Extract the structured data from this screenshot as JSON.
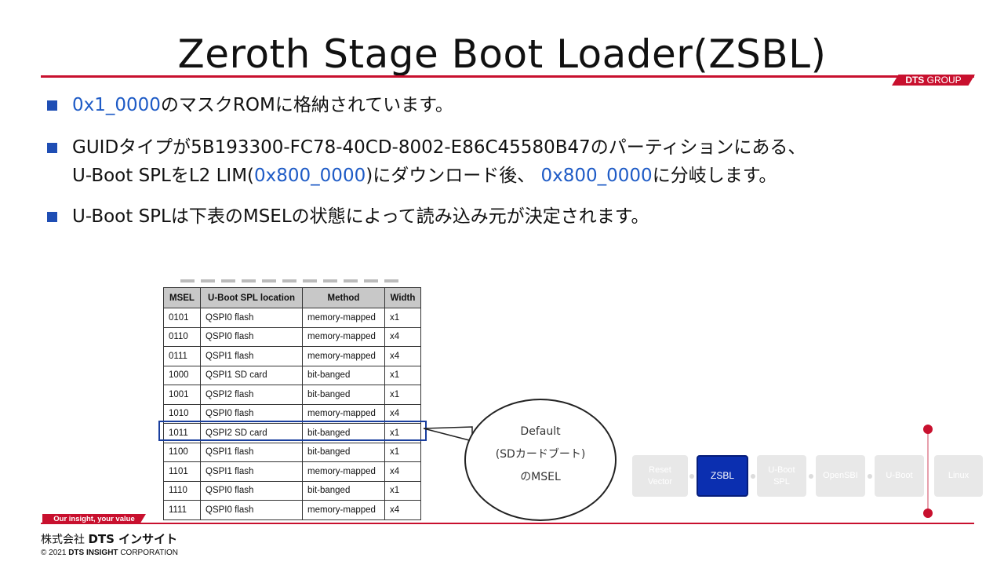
{
  "title": "Zeroth Stage Boot Loader(ZSBL)",
  "brand_tag": {
    "bold": "DTS",
    "rest": "GROUP"
  },
  "bullets": {
    "b1": {
      "hl": "0x1_0000",
      "text": "のマスクROMに格納されています。"
    },
    "b2": {
      "line1": "GUIDタイプが5B193300-FC78-40CD-8002-E86C45580B47のパーティションにある、",
      "line2_a": "U-Boot SPLをL2 LIM(",
      "line2_hl1": "0x800_0000",
      "line2_b": ")にダウンロード後、 ",
      "line2_hl2": "0x800_0000",
      "line2_c": "に分岐します。"
    },
    "b3": {
      "text": "U-Boot SPLは下表のMSELの状態によって読み込み元が決定されます。"
    }
  },
  "table": {
    "headers": [
      "MSEL",
      "U-Boot SPL location",
      "Method",
      "Width"
    ],
    "rows": [
      [
        "0101",
        "QSPI0 flash",
        "memory-mapped",
        "x1"
      ],
      [
        "0110",
        "QSPI0 flash",
        "memory-mapped",
        "x4"
      ],
      [
        "0111",
        "QSPI1 flash",
        "memory-mapped",
        "x4"
      ],
      [
        "1000",
        "QSPI1 SD card",
        "bit-banged",
        "x1"
      ],
      [
        "1001",
        "QSPI2 flash",
        "bit-banged",
        "x1"
      ],
      [
        "1010",
        "QSPI0 flash",
        "memory-mapped",
        "x4"
      ],
      [
        "1011",
        "QSPI2 SD card",
        "bit-banged",
        "x1"
      ],
      [
        "1100",
        "QSPI1 flash",
        "bit-banged",
        "x1"
      ],
      [
        "1101",
        "QSPI1 flash",
        "memory-mapped",
        "x4"
      ],
      [
        "1110",
        "QSPI0 flash",
        "bit-banged",
        "x1"
      ],
      [
        "1111",
        "QSPI0 flash",
        "memory-mapped",
        "x4"
      ]
    ],
    "highlighted_msel": "1011"
  },
  "callout": {
    "line1": "Default",
    "line2": "(SDカードブート)",
    "line3": "のMSEL"
  },
  "flow": {
    "steps": [
      "Reset Vector",
      "ZSBL",
      "U-Boot SPL",
      "OpenSBI",
      "U-Boot",
      "Linux"
    ],
    "active": "ZSBL",
    "active_color": "#0b2fb0"
  },
  "footer": {
    "tagline": "Our insight, your value",
    "corp_prefix": "株式会社",
    "corp_name": "DTS インサイト",
    "copyright_prefix": "© 2021",
    "copyright_bold": "DTS INSIGHT",
    "copyright_rest": "CORPORATION"
  },
  "colors": {
    "accent_red": "#c8102e",
    "highlight_blue": "#1e5bc6",
    "bullet_blue": "#1f4eb4"
  }
}
